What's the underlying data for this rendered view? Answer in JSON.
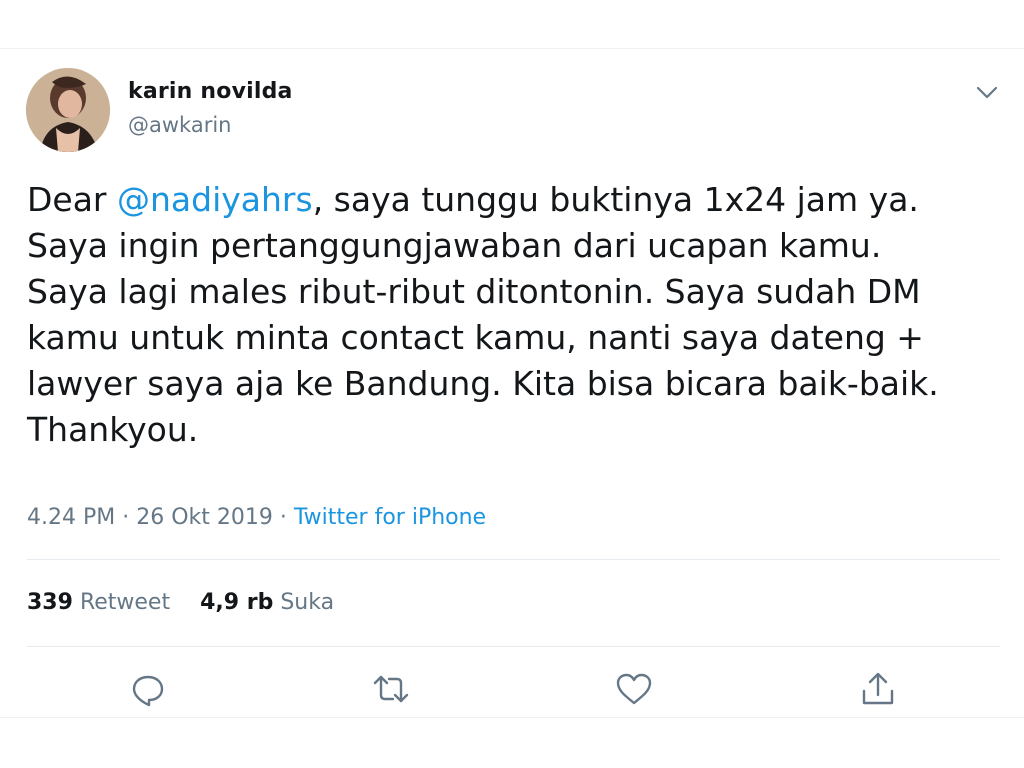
{
  "author": {
    "name": "karin novilda",
    "handle": "@awkarin"
  },
  "tweet": {
    "text_before_mention": "Dear ",
    "mention": "@nadiyahrs",
    "text_after_mention": ", saya tunggu buktinya 1x24 jam ya.\nSaya ingin pertanggungjawaban dari ucapan kamu.\nSaya lagi males ribut-ribut ditontonin. Saya sudah DM\nkamu untuk minta contact kamu, nanti saya dateng +\nlawyer saya aja ke Bandung. Kita bisa bicara baik-baik.\nThankyou."
  },
  "meta": {
    "time": "4.24 PM",
    "separator": " · ",
    "date": "26 Okt 2019",
    "source": "Twitter for iPhone"
  },
  "stats": {
    "retweets_count": "339",
    "retweets_label": "Retweet",
    "likes_count": "4,9 rb",
    "likes_label": "Suka"
  },
  "icons": {
    "menu": "chevron-down-icon",
    "reply": "reply-icon",
    "retweet": "retweet-icon",
    "like": "heart-icon",
    "share": "share-icon"
  },
  "colors": {
    "link": "#1b95e0",
    "secondary_text": "#657786",
    "primary_text": "#14171a",
    "divider": "#e6ecf0"
  }
}
